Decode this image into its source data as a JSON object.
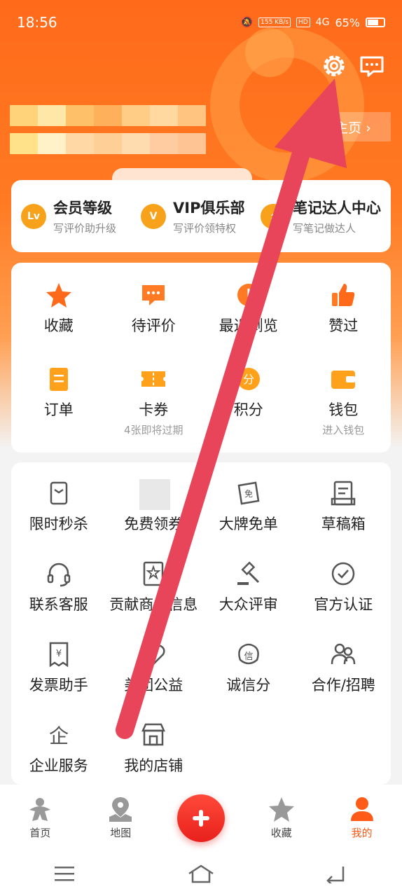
{
  "status_bar": {
    "time": "18:56",
    "net_speed": "155 KB/s",
    "hd": "HD",
    "signal": "4G",
    "battery": "65%"
  },
  "header": {
    "profile_link": "主页 ›"
  },
  "membership": [
    {
      "badge": "Lv",
      "title": "会员等级",
      "subtitle": "写评价助升级",
      "color": "#f8a21b"
    },
    {
      "badge": "V",
      "title": "VIP俱乐部",
      "subtitle": "写评价领特权",
      "color": "#f8a21b"
    },
    {
      "badge": "⚡",
      "title": "笔记达人中心",
      "subtitle": "写笔记做达人",
      "color": "#f8a21b"
    }
  ],
  "quick_grid": [
    {
      "icon": "star-icon",
      "label": "收藏",
      "sub": ""
    },
    {
      "icon": "comment-icon",
      "label": "待评价",
      "sub": ""
    },
    {
      "icon": "clock-icon",
      "label": "最近浏览",
      "sub": ""
    },
    {
      "icon": "thumbs-up-icon",
      "label": "赞过",
      "sub": ""
    },
    {
      "icon": "order-icon",
      "label": "订单",
      "sub": ""
    },
    {
      "icon": "coupon-icon",
      "label": "卡券",
      "sub": "4张即将过期"
    },
    {
      "icon": "points-icon",
      "label": "积分",
      "sub": ""
    },
    {
      "icon": "wallet-icon",
      "label": "钱包",
      "sub": "进入钱包"
    }
  ],
  "tools_grid": [
    {
      "icon": "flash-sale-icon",
      "label": "限时秒杀"
    },
    {
      "icon": "free-icon",
      "label": "免费领券"
    },
    {
      "icon": "ticket-free-icon",
      "label": "大牌免单"
    },
    {
      "icon": "draft-box-icon",
      "label": "草稿箱"
    },
    {
      "icon": "headset-icon",
      "label": "联系客服"
    },
    {
      "icon": "merchant-info-icon",
      "label": "贡献商户信息"
    },
    {
      "icon": "gavel-icon",
      "label": "大众评审"
    },
    {
      "icon": "verified-icon",
      "label": "官方认证"
    },
    {
      "icon": "invoice-icon",
      "label": "发票助手"
    },
    {
      "icon": "charity-icon",
      "label": "美团公益"
    },
    {
      "icon": "credit-icon",
      "label": "诚信分"
    },
    {
      "icon": "partner-icon",
      "label": "合作/招聘"
    },
    {
      "icon": "enterprise-icon",
      "label": "企业服务"
    },
    {
      "icon": "store-icon",
      "label": "我的店铺"
    }
  ],
  "bottom_nav": [
    {
      "icon": "home-icon",
      "label": "首页"
    },
    {
      "icon": "map-icon",
      "label": "地图"
    },
    {
      "icon": "plus-icon",
      "label": ""
    },
    {
      "icon": "star-outline-icon",
      "label": "收藏"
    },
    {
      "icon": "profile-icon",
      "label": "我的"
    }
  ],
  "colors": {
    "brand": "#ff6a1a",
    "accent_red": "#e8455a",
    "active": "#ff5a17"
  }
}
